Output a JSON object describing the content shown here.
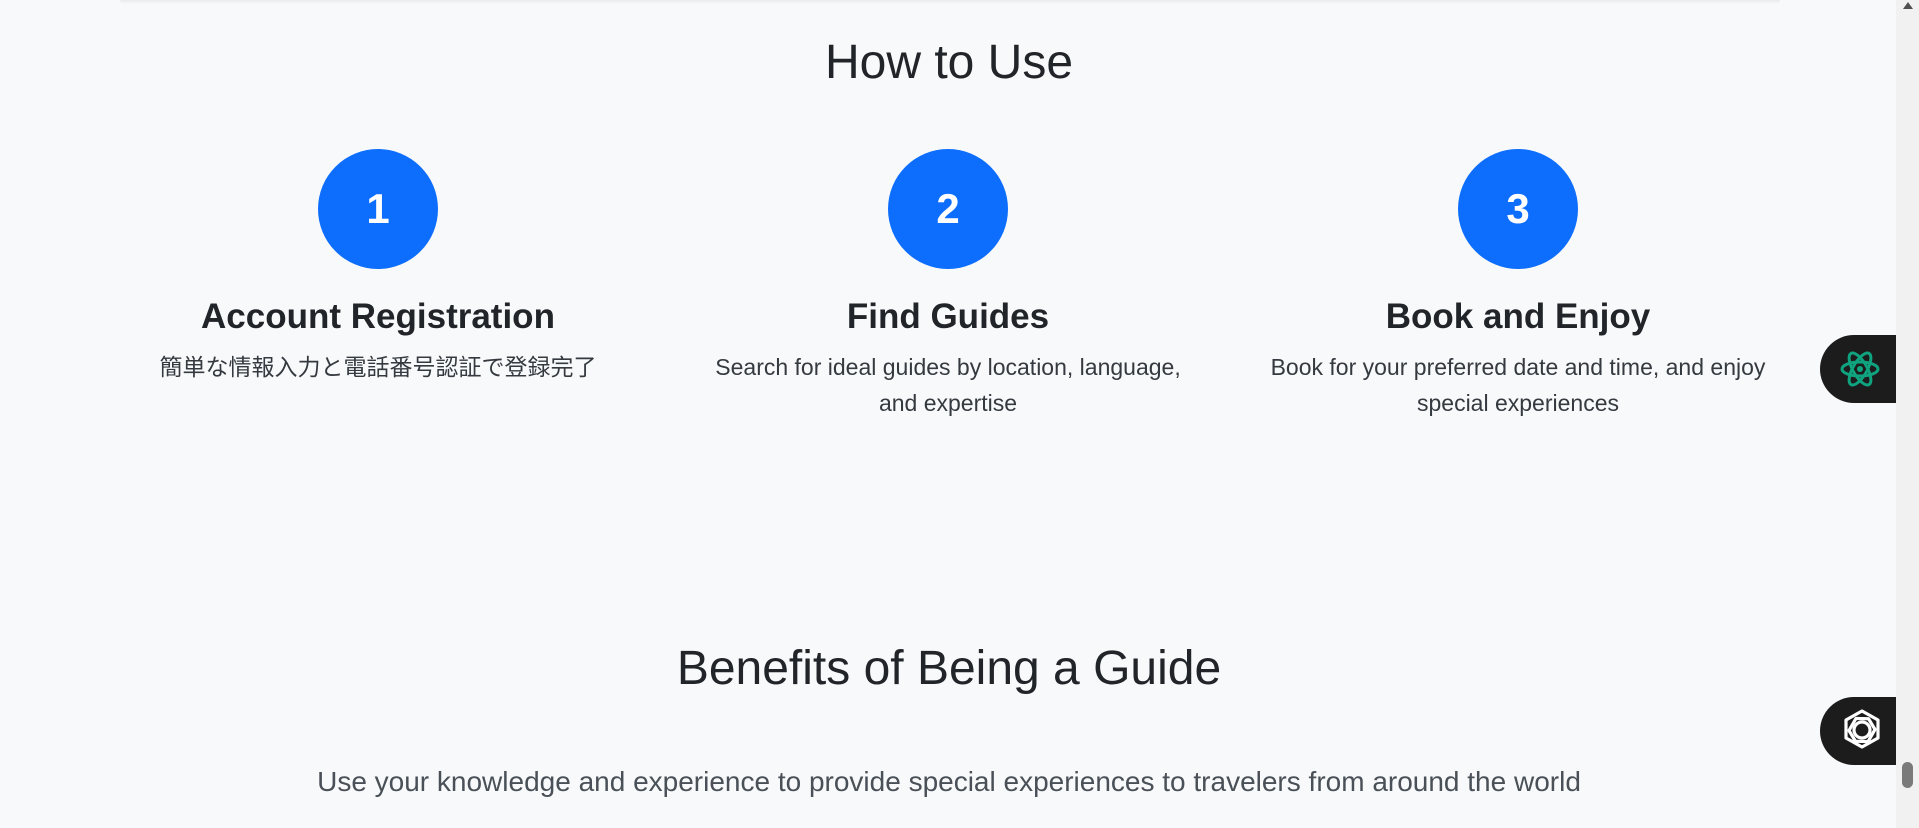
{
  "how_to_use": {
    "title": "How to Use",
    "steps": [
      {
        "number": "1",
        "title": "Account Registration",
        "description": "簡単な情報入力と電話番号認証で登録完了"
      },
      {
        "number": "2",
        "title": "Find Guides",
        "description": "Search for ideal guides by location, language, and expertise"
      },
      {
        "number": "3",
        "title": "Book and Enjoy",
        "description": "Book for your preferred date and time, and enjoy special experiences"
      }
    ]
  },
  "benefits": {
    "title": "Benefits of Being a Guide",
    "lead": "Use your knowledge and experience to provide special experiences to travelers from around the world"
  },
  "side_buttons": [
    {
      "icon": "chatgpt-icon",
      "color": "#10a37f"
    },
    {
      "icon": "hexagon-knot-icon",
      "color": "#ffffff"
    }
  ],
  "colors": {
    "accent": "#0d6efd",
    "background": "#f8f9fa",
    "text": "#212529"
  }
}
